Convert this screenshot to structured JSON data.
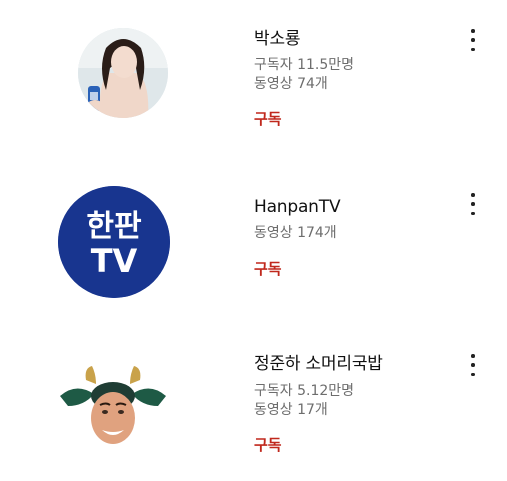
{
  "channels": [
    {
      "name": "박소룡",
      "subscribers": "구독자 11.5만명",
      "videos": "동영상 74개",
      "subscribe_label": "구독",
      "avatar_icon": "woman-with-drink-photo-icon"
    },
    {
      "name": "HanpanTV",
      "videos": "동영상 174개",
      "subscribe_label": "구독",
      "avatar_icon": "hanpan-tv-logo-icon",
      "logo_text": [
        "한판",
        "TV"
      ]
    },
    {
      "name": "정준하 소머리국밥",
      "subscribers": "구독자 5.12만명",
      "videos": "동영상 17개",
      "subscribe_label": "구독",
      "avatar_icon": "man-with-cow-ears-icon"
    }
  ],
  "colors": {
    "subscribe": "#c0281d",
    "hanpan_blue": "#18358f",
    "meta_text": "#6d6d6d"
  },
  "more_icon": "more-vertical-icon"
}
